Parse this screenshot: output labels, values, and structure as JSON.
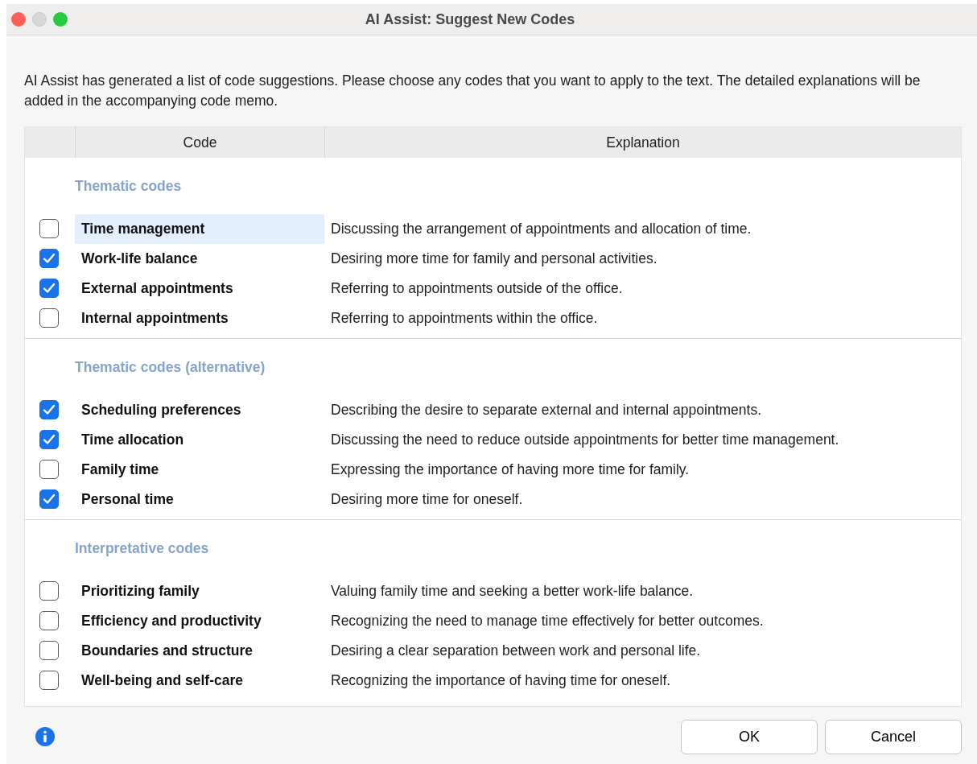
{
  "window": {
    "title": "AI Assist: Suggest New Codes"
  },
  "intro": "AI Assist has generated a list of code suggestions. Please choose any codes that you want to apply to the text. The detailed explanations will be added in the accompanying code memo.",
  "table": {
    "columns": [
      "Code",
      "Explanation"
    ],
    "groups": [
      {
        "title": "Thematic codes",
        "rows": [
          {
            "code": "Time management",
            "explanation": "Discussing the arrangement of appointments and allocation of time.",
            "checked": false,
            "selected": true
          },
          {
            "code": "Work-life balance",
            "explanation": "Desiring more time for family and personal activities.",
            "checked": true,
            "selected": false
          },
          {
            "code": "External appointments",
            "explanation": "Referring to appointments outside of the office.",
            "checked": true,
            "selected": false
          },
          {
            "code": "Internal appointments",
            "explanation": "Referring to appointments within the office.",
            "checked": false,
            "selected": false
          }
        ]
      },
      {
        "title": "Thematic codes (alternative)",
        "rows": [
          {
            "code": "Scheduling preferences",
            "explanation": "Describing the desire to separate external and internal appointments.",
            "checked": true,
            "selected": false
          },
          {
            "code": "Time allocation",
            "explanation": "Discussing the need to reduce outside appointments for better time management.",
            "checked": true,
            "selected": false
          },
          {
            "code": "Family time",
            "explanation": "Expressing the importance of having more time for family.",
            "checked": false,
            "selected": false
          },
          {
            "code": "Personal time",
            "explanation": "Desiring more time for oneself.",
            "checked": true,
            "selected": false
          }
        ]
      },
      {
        "title": "Interpretative codes",
        "rows": [
          {
            "code": "Prioritizing family",
            "explanation": "Valuing family time and seeking a better work-life balance.",
            "checked": false,
            "selected": false
          },
          {
            "code": "Efficiency and productivity",
            "explanation": "Recognizing the need to manage time effectively for better outcomes.",
            "checked": false,
            "selected": false
          },
          {
            "code": "Boundaries and structure",
            "explanation": "Desiring a clear separation between work and personal life.",
            "checked": false,
            "selected": false
          },
          {
            "code": "Well-being and self-care",
            "explanation": "Recognizing the importance of having time for oneself.",
            "checked": false,
            "selected": false
          }
        ]
      }
    ]
  },
  "buttons": [
    "OK",
    "Cancel"
  ]
}
